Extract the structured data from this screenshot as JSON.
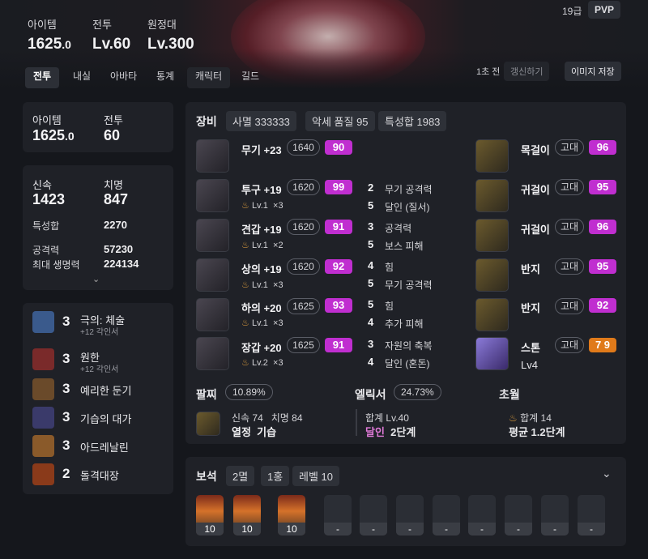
{
  "header": {
    "stats": [
      {
        "label": "아이템",
        "value": "1625",
        "decimal": ".0"
      },
      {
        "label": "전투",
        "value": "Lv.60",
        "decimal": ""
      },
      {
        "label": "원정대",
        "value": "Lv.300",
        "decimal": ""
      }
    ],
    "grade": "19급",
    "pvp": "PVP",
    "updated": "1초 전",
    "refresh": "갱신하기",
    "save_image": "이미지 저장"
  },
  "tabs": [
    "전투",
    "내실",
    "아바타",
    "통계",
    "캐릭터",
    "길드"
  ],
  "left": {
    "summary": [
      {
        "label": "아이템",
        "value": "1625",
        "decimal": ".0"
      },
      {
        "label": "전투",
        "value": "60",
        "decimal": ""
      }
    ],
    "combat": [
      {
        "label": "신속",
        "value": "1423"
      },
      {
        "label": "치명",
        "value": "847"
      }
    ],
    "specialization": {
      "label": "특성합",
      "value": "2270"
    },
    "attack": {
      "label": "공격력",
      "value": "57230"
    },
    "max_hp": {
      "label": "최대 생명력",
      "value": "224134"
    },
    "engravings": [
      {
        "level": "3",
        "name": "극의: 체술",
        "sub": "+12 각인서",
        "color": "#3a5a8c"
      },
      {
        "level": "3",
        "name": "원한",
        "sub": "+12 각인서",
        "color": "#7a2a2a"
      },
      {
        "level": "3",
        "name": "예리한 둔기",
        "sub": "",
        "color": "#6a4a2a"
      },
      {
        "level": "3",
        "name": "기습의 대가",
        "sub": "",
        "color": "#3a3a6a"
      },
      {
        "level": "3",
        "name": "아드레날린",
        "sub": "",
        "color": "#8a5a2a"
      },
      {
        "level": "2",
        "name": "돌격대장",
        "sub": "",
        "color": "#8a3a1a"
      }
    ]
  },
  "equipment": {
    "title": "장비",
    "tags": [
      "사멸 333333",
      "악세 품질 95",
      "특성합 1983"
    ],
    "items": [
      {
        "name": "무기 +23",
        "level": "1640",
        "quality": "90",
        "elixir": "",
        "elixir_count": ""
      },
      {
        "name": "투구 +19",
        "level": "1620",
        "quality": "99",
        "elixir": "Lv.1",
        "elixir_count": "×3"
      },
      {
        "name": "견갑 +19",
        "level": "1620",
        "quality": "91",
        "elixir": "Lv.1",
        "elixir_count": "×2"
      },
      {
        "name": "상의 +19",
        "level": "1620",
        "quality": "92",
        "elixir": "Lv.1",
        "elixir_count": "×3"
      },
      {
        "name": "하의 +20",
        "level": "1625",
        "quality": "93",
        "elixir": "Lv.1",
        "elixir_count": "×3"
      },
      {
        "name": "장갑 +20",
        "level": "1625",
        "quality": "91",
        "elixir": "Lv.2",
        "elixir_count": "×3"
      }
    ],
    "effects": [
      {
        "n": "2",
        "t": "무기 공격력"
      },
      {
        "n": "5",
        "t": "달인 (질서)"
      },
      {
        "n": "3",
        "t": "공격력"
      },
      {
        "n": "5",
        "t": "보스 피해"
      },
      {
        "n": "4",
        "t": "힘"
      },
      {
        "n": "5",
        "t": "무기 공격력"
      },
      {
        "n": "5",
        "t": "힘"
      },
      {
        "n": "4",
        "t": "추가 피해"
      },
      {
        "n": "3",
        "t": "자원의 축복"
      },
      {
        "n": "4",
        "t": "달인 (혼돈)"
      }
    ],
    "accessories": [
      {
        "name": "목걸이",
        "grade": "고대",
        "quality": "96"
      },
      {
        "name": "귀걸이",
        "grade": "고대",
        "quality": "95"
      },
      {
        "name": "귀걸이",
        "grade": "고대",
        "quality": "96"
      },
      {
        "name": "반지",
        "grade": "고대",
        "quality": "95"
      },
      {
        "name": "반지",
        "grade": "고대",
        "quality": "92"
      }
    ],
    "stone": {
      "name": "스톤",
      "grade": "고대",
      "quality": "7 9",
      "level": "Lv4"
    }
  },
  "bracelet": {
    "title": "팔찌",
    "pct": "10.89%",
    "line1": "신속 74   치명 84",
    "line2": "열정  기습"
  },
  "elixir": {
    "title": "엘릭서",
    "pct": "24.73%",
    "line1": "합계 Lv.40",
    "line2_a": "달인",
    "line2_b": "2단계"
  },
  "transcend": {
    "title": "초월",
    "line1": "합계 14",
    "line2": "평균 1.2단계"
  },
  "gems": {
    "title": "보석",
    "tags": [
      "2멸",
      "1홍",
      "레벨 10"
    ],
    "filled": [
      "10",
      "10",
      "10"
    ],
    "empty": [
      "-",
      "-",
      "-",
      "-",
      "-",
      "-",
      "-",
      "-"
    ]
  }
}
